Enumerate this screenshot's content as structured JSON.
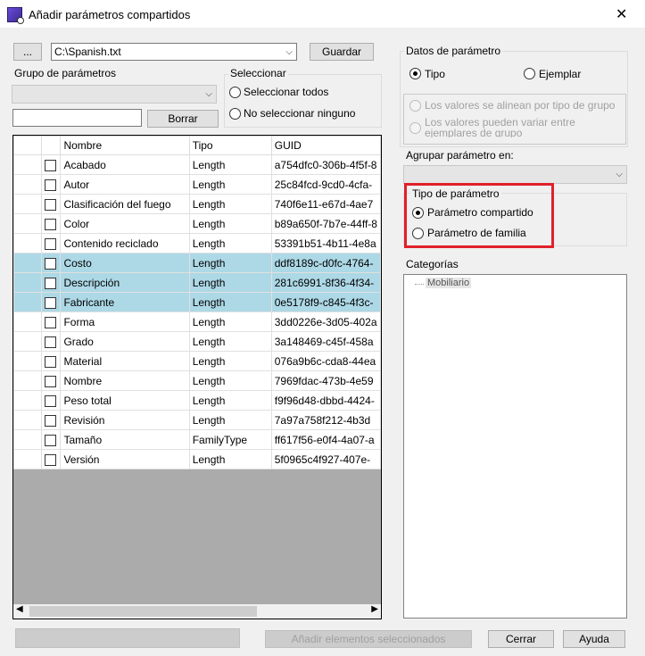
{
  "window": {
    "title": "Añadir parámetros compartidos",
    "close": "✕"
  },
  "file": {
    "browse_label": "...",
    "path": "C:\\Spanish.txt",
    "save_label": "Guardar"
  },
  "group": {
    "label": "Grupo de parámetros",
    "delete_label": "Borrar"
  },
  "select": {
    "label": "Seleccionar",
    "all": "Seleccionar todos",
    "none": "No seleccionar ninguno"
  },
  "table": {
    "headers": [
      "",
      "Nombre",
      "Tipo",
      "GUID"
    ],
    "rows": [
      {
        "name": "Acabado",
        "type": "Length",
        "guid": "a754dfc0-306b-4f5f-8",
        "selected": false
      },
      {
        "name": "Autor",
        "type": "Length",
        "guid": "25c84fcd-9cd0-4cfa-",
        "selected": false
      },
      {
        "name": "Clasificación del fuego",
        "type": "Length",
        "guid": "740f6e11-e67d-4ae7",
        "selected": false
      },
      {
        "name": "Color",
        "type": "Length",
        "guid": "b89a650f-7b7e-44ff-8",
        "selected": false
      },
      {
        "name": "Contenido reciclado",
        "type": "Length",
        "guid": "53391b51-4b11-4e8a",
        "selected": false
      },
      {
        "name": "Costo",
        "type": "Length",
        "guid": "ddf8189c-d0fc-4764-",
        "selected": true
      },
      {
        "name": "Descripción",
        "type": "Length",
        "guid": "281c6991-8f36-4f34-",
        "selected": true
      },
      {
        "name": "Fabricante",
        "type": "Length",
        "guid": "0e5178f9-c845-4f3c-",
        "selected": true
      },
      {
        "name": "Forma",
        "type": "Length",
        "guid": "3dd0226e-3d05-402a",
        "selected": false
      },
      {
        "name": "Grado",
        "type": "Length",
        "guid": "3a148469-c45f-458a",
        "selected": false
      },
      {
        "name": "Material",
        "type": "Length",
        "guid": "076a9b6c-cda8-44ea",
        "selected": false
      },
      {
        "name": "Nombre",
        "type": "Length",
        "guid": "7969fdac-473b-4e59",
        "selected": false
      },
      {
        "name": "Peso total",
        "type": "Length",
        "guid": "f9f96d48-dbbd-4424-",
        "selected": false
      },
      {
        "name": "Revisión",
        "type": "Length",
        "guid": "7a97a758f212-4b3d",
        "selected": false
      },
      {
        "name": "Tamaño",
        "type": "FamilyType",
        "guid": "ff617f56-e0f4-4a07-a",
        "selected": false
      },
      {
        "name": "Versión",
        "type": "Length",
        "guid": "5f0965c4f927-407e-",
        "selected": false
      }
    ]
  },
  "param_data": {
    "label": "Datos de parámetro",
    "type_label": "Tipo",
    "instance_label": "Ejemplar",
    "align_label": "Los valores se alinean por tipo de grupo",
    "vary_label": "Los valores pueden variar entre ejemplares de grupo",
    "group_under_label": "Agrupar parámetro en:"
  },
  "param_type": {
    "label": "Tipo de parámetro",
    "shared": "Parámetro compartido",
    "family": "Parámetro de familia"
  },
  "categories": {
    "label": "Categorías",
    "items": [
      "Mobiliario"
    ]
  },
  "footer": {
    "add_label": "Añadir elementos seleccionados",
    "close_label": "Cerrar",
    "help_label": "Ayuda"
  },
  "colors": {
    "selected_row": "#add8e6",
    "highlight": "#e0202a"
  }
}
